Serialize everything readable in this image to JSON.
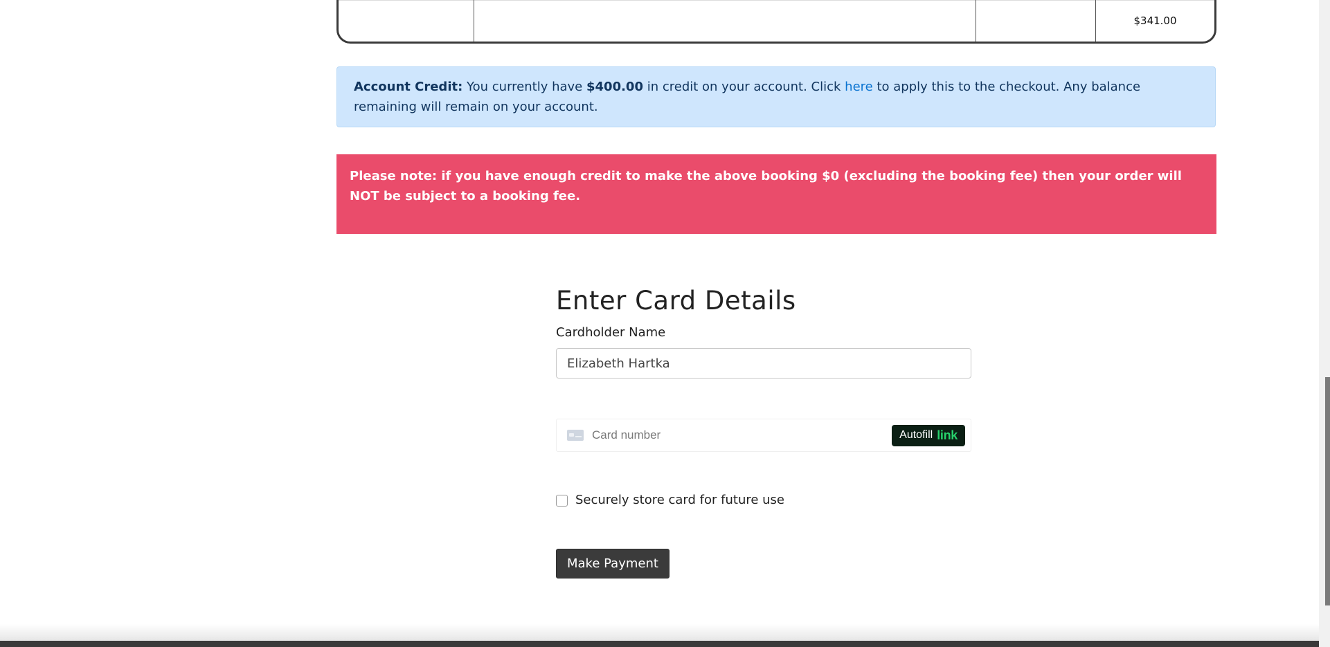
{
  "order_table": {
    "last_row_total": "$341.00"
  },
  "credit_alert": {
    "label": "Account Credit:",
    "text_before_amount": "You currently have",
    "amount": "$400.00",
    "text_before_link": "in credit on your account. Click",
    "link_text": "here",
    "text_after_link": "to apply this to the checkout. Any balance remaining will remain on your account."
  },
  "fee_note": {
    "text": "Please note: if you have enough credit to make the above booking $0 (excluding the booking fee) then your order will NOT be subject to a booking fee."
  },
  "card_form": {
    "title": "Enter Card Details",
    "cardholder_label": "Cardholder Name",
    "cardholder_value": "Elizabeth Hartka",
    "card_number_placeholder": "Card number",
    "autofill_label": "Autofill",
    "autofill_brand": "link",
    "store_card_label": "Securely store card for future use",
    "store_card_checked": false,
    "submit_label": "Make Payment"
  },
  "icons": {
    "card": "credit-card-icon"
  }
}
